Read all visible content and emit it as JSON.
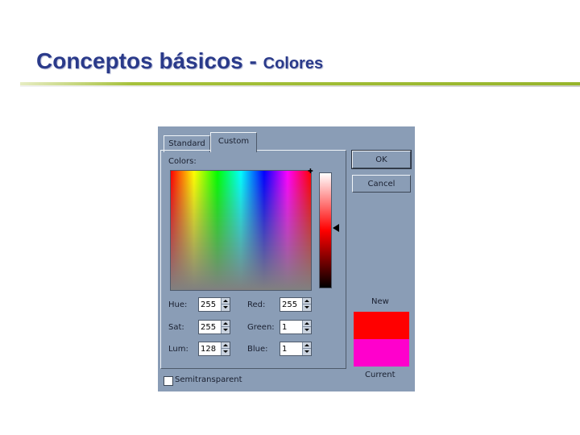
{
  "slide": {
    "title_main": "Conceptos básicos - ",
    "title_sub": "Colores"
  },
  "dialog": {
    "tabs": [
      "Standard",
      "Custom"
    ],
    "active_tab": "Custom",
    "colors_label": "Colors:",
    "ok_label": "OK",
    "cancel_label": "Cancel",
    "new_label": "New",
    "current_label": "Current",
    "new_color": "#ff0000",
    "current_color": "#ff00cc",
    "semitransparent_label": "Semitransparent",
    "semitransparent_checked": false,
    "fields": {
      "hue": {
        "label": "Hue:",
        "value": "255"
      },
      "sat": {
        "label": "Sat:",
        "value": "255"
      },
      "lum": {
        "label": "Lum:",
        "value": "128"
      },
      "red": {
        "label": "Red:",
        "value": "255"
      },
      "green": {
        "label": "Green:",
        "value": "1"
      },
      "blue": {
        "label": "Blue:",
        "value": "1"
      }
    }
  },
  "colors": {
    "title": "#2a3a8a",
    "rule": "#97b52c",
    "dialog_bg": "#8a9db6"
  }
}
